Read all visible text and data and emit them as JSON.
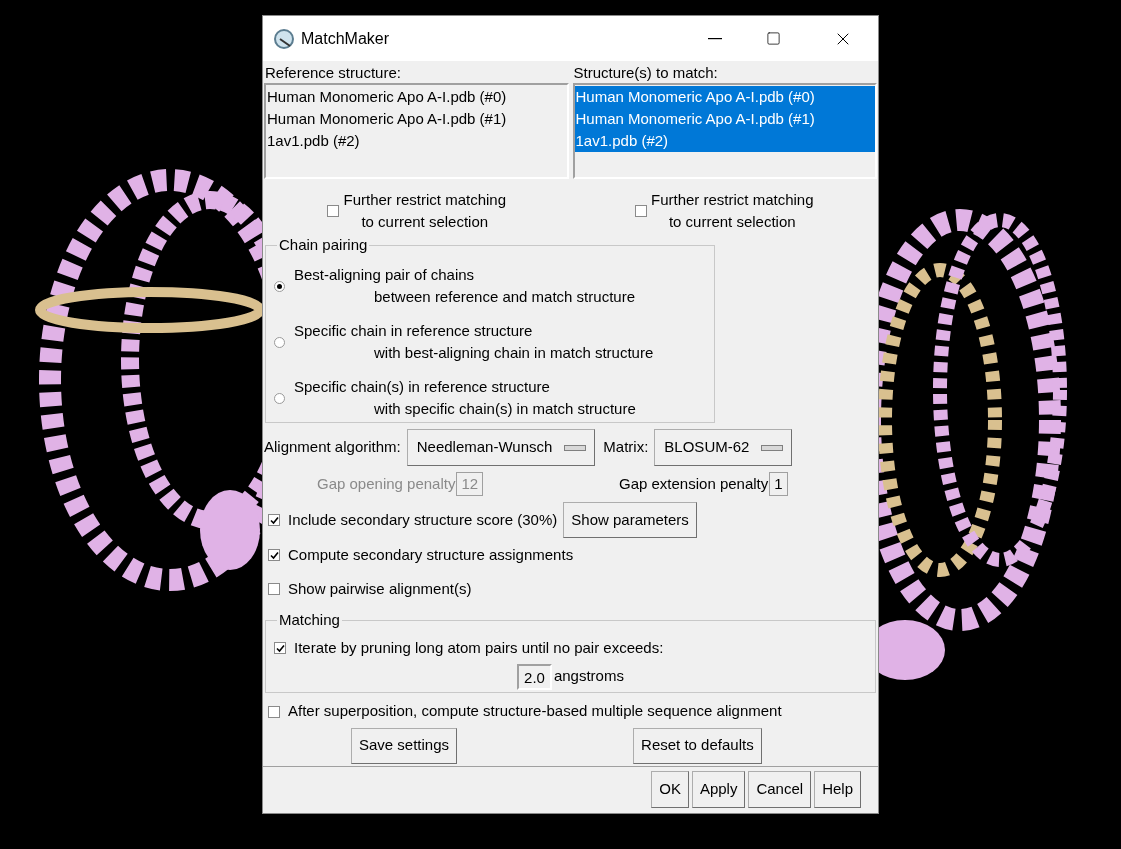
{
  "window": {
    "title": "MatchMaker"
  },
  "reference": {
    "label": "Reference structure:",
    "items": [
      {
        "text": "Human Monomeric Apo A-I.pdb (#0)",
        "selected": false
      },
      {
        "text": "Human Monomeric Apo A-I.pdb (#1)",
        "selected": false
      },
      {
        "text": "1av1.pdb (#2)",
        "selected": false
      }
    ],
    "restrict": {
      "lines": [
        "Further restrict matching",
        "to current selection"
      ],
      "checked": false
    }
  },
  "match": {
    "label": "Structure(s) to match:",
    "items": [
      {
        "text": "Human Monomeric Apo A-I.pdb (#0)",
        "selected": true
      },
      {
        "text": "Human Monomeric Apo A-I.pdb (#1)",
        "selected": true
      },
      {
        "text": "1av1.pdb (#2)",
        "selected": true
      }
    ],
    "restrict": {
      "lines": [
        "Further restrict matching",
        "to current selection"
      ],
      "checked": false
    }
  },
  "chain_pairing": {
    "title": "Chain pairing",
    "options": [
      {
        "lines": [
          "Best-aligning pair of chains",
          "between reference and match structure"
        ],
        "selected": true
      },
      {
        "lines": [
          "Specific chain in reference structure",
          "with best-aligning chain in match structure"
        ],
        "selected": false
      },
      {
        "lines": [
          "Specific chain(s) in reference structure",
          "with specific chain(s) in match structure"
        ],
        "selected": false
      }
    ]
  },
  "algorithm": {
    "label": "Alignment algorithm:",
    "value": "Needleman-Wunsch"
  },
  "matrix": {
    "label": "Matrix:",
    "value": "BLOSUM-62"
  },
  "gap_opening": {
    "label": "Gap opening penalty",
    "value": "12",
    "disabled": true
  },
  "gap_extension": {
    "label": "Gap extension penalty",
    "value": "1",
    "disabled": false
  },
  "options": [
    {
      "label": "Include secondary structure score (30%)",
      "checked": true,
      "button": "Show parameters"
    },
    {
      "label": "Compute secondary structure assignments",
      "checked": true
    },
    {
      "label": "Show pairwise alignment(s)",
      "checked": false
    }
  ],
  "matching": {
    "title": "Matching",
    "iterate": {
      "label": "Iterate by pruning long atom pairs until no pair exceeds:",
      "checked": true
    },
    "cutoff": {
      "value": "2.0",
      "unit": "angstroms"
    }
  },
  "msa": {
    "label": "After superposition, compute structure-based multiple sequence alignment",
    "checked": false
  },
  "settings_buttons": [
    "Save settings",
    "Reset to defaults"
  ],
  "buttons": [
    "OK",
    "Apply",
    "Cancel",
    "Help"
  ]
}
